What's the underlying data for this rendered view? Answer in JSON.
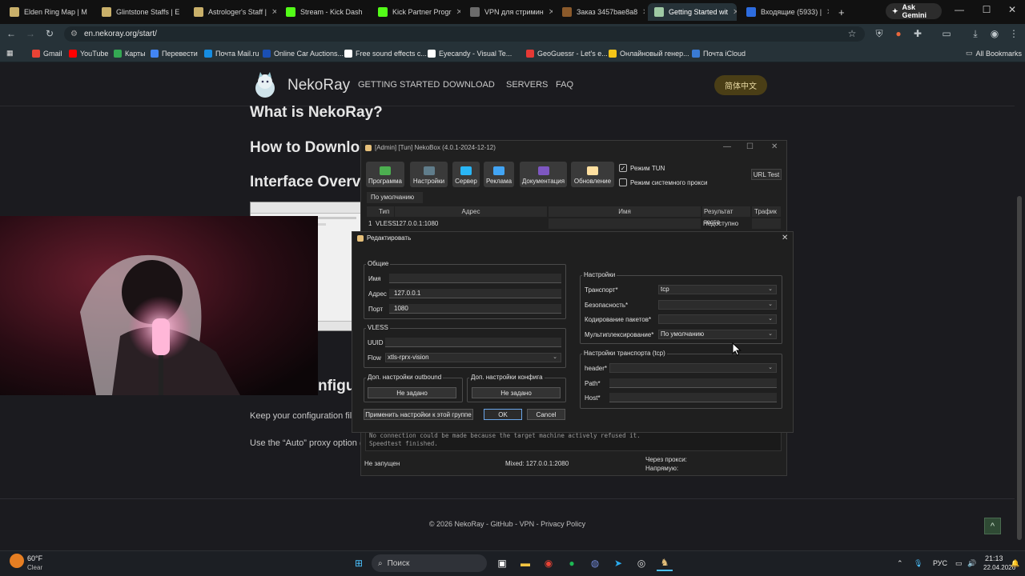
{
  "browser": {
    "tabs": [
      {
        "title": "Elden Ring Map | M",
        "color": "#c9b06a",
        "active": false
      },
      {
        "title": "Glintstone Staffs | E",
        "color": "#c9b06a",
        "active": false
      },
      {
        "title": "Astrologer's Staff |",
        "color": "#c9b06a",
        "active": false
      },
      {
        "title": "Stream - Kick Dash",
        "color": "#53fc18",
        "active": false
      },
      {
        "title": "Kick Partner Progr",
        "color": "#53fc18",
        "active": false
      },
      {
        "title": "VPN для стримин",
        "color": "#6b6b6b",
        "active": false
      },
      {
        "title": "Заказ 3457bae8a8",
        "color": "#8b5a2b",
        "active": false
      },
      {
        "title": "Getting Started wit",
        "color": "#9fc9a4",
        "active": true
      },
      {
        "title": "Входящие (5933) |",
        "color": "#2d6cdf",
        "active": false
      }
    ],
    "ask_gemini": "Ask Gemini",
    "url": "en.nekoray.org/start/",
    "bookmarks": [
      {
        "label": "Gmail",
        "color": "#ea4335"
      },
      {
        "label": "YouTube",
        "color": "#ff0000"
      },
      {
        "label": "Карты",
        "color": "#34a853"
      },
      {
        "label": "Перевести",
        "color": "#4285f4"
      },
      {
        "label": "Почта Mail.ru",
        "color": "#168de2"
      },
      {
        "label": "Online Car Auctions...",
        "color": "#1a4fb4"
      },
      {
        "label": "Free sound effects c...",
        "color": "#ffffff"
      },
      {
        "label": "Eyecandy - Visual Te...",
        "color": "#ffffff"
      },
      {
        "label": "GeoGuessr - Let's e...",
        "color": "#e53935"
      },
      {
        "label": "Онлайновый генер...",
        "color": "#f5c518"
      },
      {
        "label": "Почта iCloud",
        "color": "#3a7bd5"
      }
    ],
    "all_bookmarks": "All Bookmarks"
  },
  "site": {
    "name": "NekoRay",
    "nav": [
      "GETTING STARTED",
      "DOWNLOAD",
      "SERVERS",
      "FAQ"
    ],
    "lang_button": "简体中文",
    "headings": [
      "What is NekoRay?",
      "How to Downlo",
      "Interface Overv",
      "nfigu"
    ],
    "paragraphs": [
      "Keep your configuration file",
      "Use the “Auto” proxy option ("
    ],
    "footer": "© 2026 NekoRay - GitHub - VPN - Privacy Policy",
    "to_top": "^"
  },
  "nekobox": {
    "title": "[Admin] [Tun] NekoBox (4.0.1-2024-12-12)",
    "toolbar": [
      {
        "label": "Программа",
        "color": "#4caf50",
        "dropdown": true
      },
      {
        "label": "Настройки",
        "color": "#607d8b",
        "dropdown": true
      },
      {
        "label": "Сервер",
        "color": "#29b6f6",
        "dropdown": true
      },
      {
        "label": "Реклама",
        "color": "#42a5f5",
        "dropdown": false
      },
      {
        "label": "Документация",
        "color": "#7e57c2",
        "dropdown": false
      },
      {
        "label": "Обновление",
        "color": "#ffe0a0",
        "dropdown": false
      }
    ],
    "tun_mode": "Режим TUN",
    "system_proxy": "Режим системного прокси",
    "url_test": "URL Test",
    "group_tab": "По умолчанию",
    "columns": [
      "Тип",
      "Адрес",
      "Имя",
      "Результат теста",
      "Трафик"
    ],
    "row": {
      "index": "1",
      "type": "VLESS",
      "address": "127.0.0.1:1080",
      "name": "",
      "result": "Недоступно",
      "traffic": ""
    },
    "log_lines": [
      "No connection could be made because the target machine actively refused it.",
      "Speedtest finished."
    ],
    "status": {
      "state": "Не запущен",
      "mixed": "Mixed: 127.0.0.1:2080",
      "via_proxy": "Через прокси:",
      "direct": "Напрямую:"
    }
  },
  "dialog": {
    "title": "Редактировать",
    "general": {
      "legend": "Общие",
      "name_label": "Имя",
      "name_value": "",
      "address_label": "Адрес",
      "address_value": "127.0.0.1",
      "port_label": "Порт",
      "port_value": "1080"
    },
    "vless": {
      "legend": "VLESS",
      "uuid_label": "UUID",
      "uuid_value": "",
      "flow_label": "Flow",
      "flow_value": "xtls-rprx-vision"
    },
    "outbound": {
      "legend": "Доп. настройки outbound",
      "button": "Не задано"
    },
    "config": {
      "legend": "Доп. настройки конфига",
      "button": "Не задано"
    },
    "apply_group": "Применить настройки к этой группе",
    "ok": "OK",
    "cancel": "Cancel",
    "settings": {
      "legend": "Настройки",
      "transport_label": "Транспорт*",
      "transport_value": "tcp",
      "security_label": "Безопасность*",
      "security_value": "",
      "encoding_label": "Кодирование пакетов*",
      "encoding_value": "",
      "mux_label": "Мультиплексирование*",
      "mux_value": "По умолчанию"
    },
    "transport": {
      "legend": "Настройки транспорта (tcp)",
      "header_label": "header*",
      "header_value": "",
      "path_label": "Path*",
      "path_value": "",
      "host_label": "Host*",
      "host_value": ""
    }
  },
  "taskbar": {
    "weather_temp": "60°F",
    "weather_desc": "Clear",
    "search_placeholder": "Поиск",
    "lang": "РУС",
    "time": "21:13",
    "date": "22.04.2026"
  }
}
